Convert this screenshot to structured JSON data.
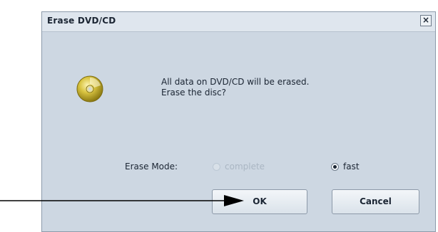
{
  "dialog": {
    "title": "Erase DVD/CD",
    "close_symbol": "×",
    "icon": "disc-icon",
    "message_line1": "All data on DVD/CD will be erased.",
    "message_line2": "Erase the disc?"
  },
  "erase_mode": {
    "label": "Erase Mode:",
    "options": [
      {
        "label": "complete",
        "selected": false,
        "enabled": false
      },
      {
        "label": "fast",
        "selected": true,
        "enabled": true
      }
    ]
  },
  "buttons": {
    "ok": "OK",
    "cancel": "Cancel"
  },
  "colors": {
    "dialog_bg": "#cdd7e2",
    "titlebar_bg": "#dfe6ee",
    "disabled_text": "#aab6c3"
  }
}
